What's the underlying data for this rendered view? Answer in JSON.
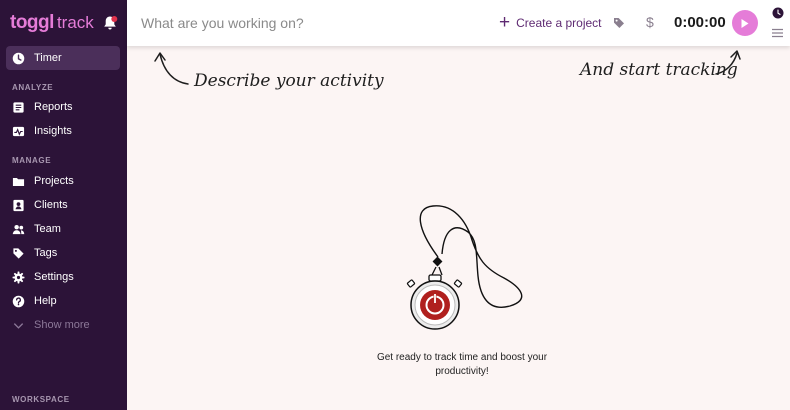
{
  "brand": {
    "logo_toggl": "toggl",
    "logo_track": "track"
  },
  "sidebar": {
    "timer": "Timer",
    "analyze_label": "ANALYZE",
    "reports": "Reports",
    "insights": "Insights",
    "manage_label": "MANAGE",
    "projects": "Projects",
    "clients": "Clients",
    "team": "Team",
    "tags": "Tags",
    "settings": "Settings",
    "help": "Help",
    "show_more": "Show more",
    "workspace_label": "WORKSPACE"
  },
  "topbar": {
    "description_placeholder": "What are you working on?",
    "create_project": "Create a project",
    "billable_symbol": "$",
    "timer": "0:00:00"
  },
  "hints": {
    "describe": "Describe your activity",
    "start": "And start tracking"
  },
  "empty_state": {
    "line1": "Get ready to track time and boost your",
    "line2": "productivity!"
  },
  "colors": {
    "sidebar_bg": "#2c1338",
    "accent": "#e57cd8",
    "page_bg": "#fcf5f4",
    "link": "#5e2a72"
  }
}
